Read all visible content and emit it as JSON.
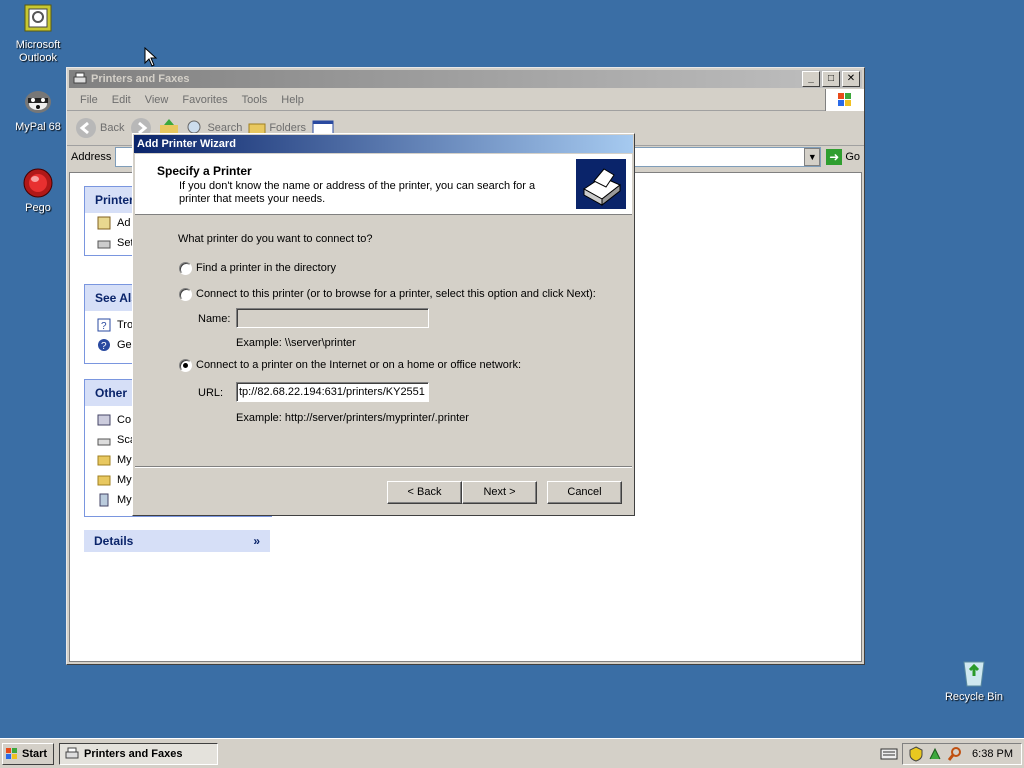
{
  "desktop": {
    "icons": [
      {
        "label": "Microsoft Outlook",
        "icon": "outlook-icon"
      },
      {
        "label": "MyPal 68",
        "icon": "mypal-icon"
      },
      {
        "label": "Pego",
        "icon": "pego-icon"
      },
      {
        "label": "Recycle Bin",
        "icon": "recycle-bin-icon"
      }
    ]
  },
  "window": {
    "title": "Printers and Faxes",
    "menu": [
      "File",
      "Edit",
      "View",
      "Favorites",
      "Tools",
      "Help"
    ],
    "toolbar": {
      "back": "Back",
      "search": "Search",
      "folders": "Folders"
    },
    "address_label": "Address",
    "go_label": "Go",
    "task_panels": {
      "printer_tasks": {
        "header": "Printer",
        "items": [
          "Ad",
          "Set"
        ]
      },
      "see_also": {
        "header": "See Als",
        "items": [
          "Tro",
          "Ge"
        ]
      },
      "other_places": {
        "header": "Other",
        "items": [
          "Co",
          "Sca",
          "My",
          "My",
          "My"
        ]
      },
      "details": {
        "header": "Details"
      }
    }
  },
  "wizard": {
    "title": "Add Printer Wizard",
    "heading": "Specify a Printer",
    "subheading": "If you don't know the name or address of the printer, you can search for a printer that meets your needs.",
    "question": "What printer do you want to connect to?",
    "options": [
      {
        "label": "Find a printer in the directory",
        "selected": false
      },
      {
        "label": "Connect to this printer (or to browse for a printer, select this option and click Next):",
        "selected": false
      },
      {
        "label": "Connect to a printer on the Internet or on a home or office network:",
        "selected": true
      }
    ],
    "name_label": "Name:",
    "name_value": "",
    "name_example": "Example: \\\\server\\printer",
    "url_label": "URL:",
    "url_value": "tp://82.68.22.194:631/printers/KY2551",
    "url_example": "Example: http://server/printers/myprinter/.printer",
    "buttons": {
      "back": "< Back",
      "next": "Next >",
      "cancel": "Cancel"
    }
  },
  "taskbar": {
    "start": "Start",
    "task": "Printers and Faxes",
    "clock": "6:38 PM"
  },
  "colors": {
    "desktop": "#3a6ea5",
    "title_active": "#0a246a",
    "title_inactive": "#808080"
  }
}
